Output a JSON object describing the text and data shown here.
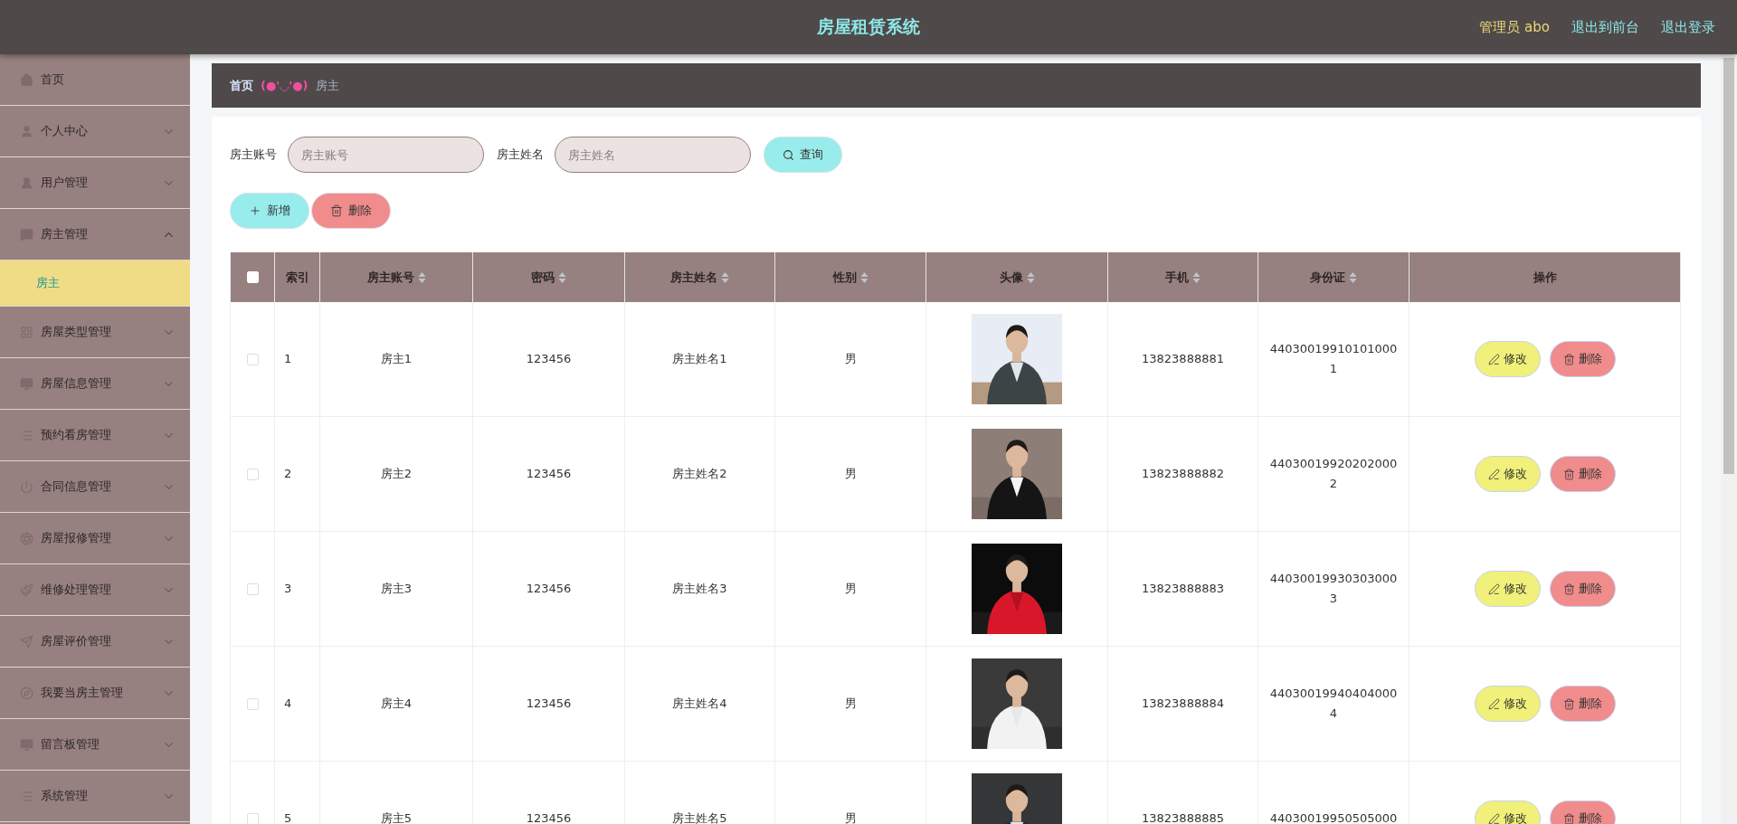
{
  "header": {
    "title": "房屋租赁系统",
    "user": "管理员 abo",
    "links": [
      "退出到前台",
      "退出登录"
    ]
  },
  "sidebar": {
    "items": [
      {
        "label": "首页",
        "expandable": false
      },
      {
        "label": "个人中心",
        "expandable": true,
        "expanded": false
      },
      {
        "label": "用户管理",
        "expandable": true,
        "expanded": false
      },
      {
        "label": "房主管理",
        "expandable": true,
        "expanded": true,
        "children": [
          {
            "label": "房主",
            "selected": true
          }
        ]
      },
      {
        "label": "房屋类型管理",
        "expandable": true,
        "expanded": false
      },
      {
        "label": "房屋信息管理",
        "expandable": true,
        "expanded": false
      },
      {
        "label": "预约看房管理",
        "expandable": true,
        "expanded": false
      },
      {
        "label": "合同信息管理",
        "expandable": true,
        "expanded": false
      },
      {
        "label": "房屋报修管理",
        "expandable": true,
        "expanded": false
      },
      {
        "label": "维修处理管理",
        "expandable": true,
        "expanded": false
      },
      {
        "label": "房屋评价管理",
        "expandable": true,
        "expanded": false
      },
      {
        "label": "我要当房主管理",
        "expandable": true,
        "expanded": false
      },
      {
        "label": "留言板管理",
        "expandable": true,
        "expanded": false
      },
      {
        "label": "系统管理",
        "expandable": true,
        "expanded": false
      }
    ]
  },
  "breadcrumb": {
    "home": "首页",
    "separator": "(●'◡'●)",
    "current": "房主"
  },
  "search": {
    "fields": [
      {
        "label": "房主账号",
        "placeholder": "房主账号"
      },
      {
        "label": "房主姓名",
        "placeholder": "房主姓名"
      }
    ],
    "button": "查询"
  },
  "actions": [
    {
      "label": "新增",
      "kind": "add"
    },
    {
      "label": "删除",
      "kind": "delete"
    }
  ],
  "table": {
    "all_checked": false,
    "columns": [
      {
        "label": "索引",
        "sortable": false
      },
      {
        "label": "房主账号",
        "sortable": true
      },
      {
        "label": "密码",
        "sortable": true
      },
      {
        "label": "房主姓名",
        "sortable": true
      },
      {
        "label": "性别",
        "sortable": true
      },
      {
        "label": "头像",
        "sortable": true
      },
      {
        "label": "手机",
        "sortable": true
      },
      {
        "label": "身份证",
        "sortable": true
      },
      {
        "label": "操作",
        "sortable": false
      }
    ],
    "rows": [
      {
        "checked": false,
        "index": "1",
        "account": "房主1",
        "password": "123456",
        "name": "房主姓名1",
        "gender": "男",
        "phone": "13823888881",
        "id_card": "440300199101010001",
        "actions": [
          "修改",
          "删除"
        ]
      },
      {
        "checked": false,
        "index": "2",
        "account": "房主2",
        "password": "123456",
        "name": "房主姓名2",
        "gender": "男",
        "phone": "13823888882",
        "id_card": "440300199202020002",
        "actions": [
          "修改",
          "删除"
        ]
      },
      {
        "checked": false,
        "index": "3",
        "account": "房主3",
        "password": "123456",
        "name": "房主姓名3",
        "gender": "男",
        "phone": "13823888883",
        "id_card": "440300199303030003",
        "actions": [
          "修改",
          "删除"
        ]
      },
      {
        "checked": false,
        "index": "4",
        "account": "房主4",
        "password": "123456",
        "name": "房主姓名4",
        "gender": "男",
        "phone": "13823888884",
        "id_card": "440300199404040004",
        "actions": [
          "修改",
          "删除"
        ]
      },
      {
        "checked": false,
        "index": "5",
        "account": "房主5",
        "password": "123456",
        "name": "房主姓名5",
        "gender": "男",
        "phone": "13823888885",
        "id_card": "44030019950505000",
        "actions": [
          "修改",
          "删除"
        ]
      }
    ]
  }
}
